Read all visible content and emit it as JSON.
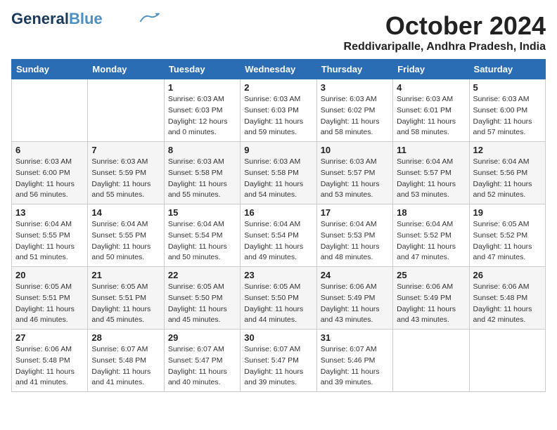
{
  "logo": {
    "line1": "General",
    "line2": "Blue"
  },
  "title": "October 2024",
  "location": "Reddivaripalle, Andhra Pradesh, India",
  "weekdays": [
    "Sunday",
    "Monday",
    "Tuesday",
    "Wednesday",
    "Thursday",
    "Friday",
    "Saturday"
  ],
  "weeks": [
    [
      {
        "day": "",
        "info": ""
      },
      {
        "day": "",
        "info": ""
      },
      {
        "day": "1",
        "info": "Sunrise: 6:03 AM\nSunset: 6:03 PM\nDaylight: 12 hours\nand 0 minutes."
      },
      {
        "day": "2",
        "info": "Sunrise: 6:03 AM\nSunset: 6:03 PM\nDaylight: 11 hours\nand 59 minutes."
      },
      {
        "day": "3",
        "info": "Sunrise: 6:03 AM\nSunset: 6:02 PM\nDaylight: 11 hours\nand 58 minutes."
      },
      {
        "day": "4",
        "info": "Sunrise: 6:03 AM\nSunset: 6:01 PM\nDaylight: 11 hours\nand 58 minutes."
      },
      {
        "day": "5",
        "info": "Sunrise: 6:03 AM\nSunset: 6:00 PM\nDaylight: 11 hours\nand 57 minutes."
      }
    ],
    [
      {
        "day": "6",
        "info": "Sunrise: 6:03 AM\nSunset: 6:00 PM\nDaylight: 11 hours\nand 56 minutes."
      },
      {
        "day": "7",
        "info": "Sunrise: 6:03 AM\nSunset: 5:59 PM\nDaylight: 11 hours\nand 55 minutes."
      },
      {
        "day": "8",
        "info": "Sunrise: 6:03 AM\nSunset: 5:58 PM\nDaylight: 11 hours\nand 55 minutes."
      },
      {
        "day": "9",
        "info": "Sunrise: 6:03 AM\nSunset: 5:58 PM\nDaylight: 11 hours\nand 54 minutes."
      },
      {
        "day": "10",
        "info": "Sunrise: 6:03 AM\nSunset: 5:57 PM\nDaylight: 11 hours\nand 53 minutes."
      },
      {
        "day": "11",
        "info": "Sunrise: 6:04 AM\nSunset: 5:57 PM\nDaylight: 11 hours\nand 53 minutes."
      },
      {
        "day": "12",
        "info": "Sunrise: 6:04 AM\nSunset: 5:56 PM\nDaylight: 11 hours\nand 52 minutes."
      }
    ],
    [
      {
        "day": "13",
        "info": "Sunrise: 6:04 AM\nSunset: 5:55 PM\nDaylight: 11 hours\nand 51 minutes."
      },
      {
        "day": "14",
        "info": "Sunrise: 6:04 AM\nSunset: 5:55 PM\nDaylight: 11 hours\nand 50 minutes."
      },
      {
        "day": "15",
        "info": "Sunrise: 6:04 AM\nSunset: 5:54 PM\nDaylight: 11 hours\nand 50 minutes."
      },
      {
        "day": "16",
        "info": "Sunrise: 6:04 AM\nSunset: 5:54 PM\nDaylight: 11 hours\nand 49 minutes."
      },
      {
        "day": "17",
        "info": "Sunrise: 6:04 AM\nSunset: 5:53 PM\nDaylight: 11 hours\nand 48 minutes."
      },
      {
        "day": "18",
        "info": "Sunrise: 6:04 AM\nSunset: 5:52 PM\nDaylight: 11 hours\nand 47 minutes."
      },
      {
        "day": "19",
        "info": "Sunrise: 6:05 AM\nSunset: 5:52 PM\nDaylight: 11 hours\nand 47 minutes."
      }
    ],
    [
      {
        "day": "20",
        "info": "Sunrise: 6:05 AM\nSunset: 5:51 PM\nDaylight: 11 hours\nand 46 minutes."
      },
      {
        "day": "21",
        "info": "Sunrise: 6:05 AM\nSunset: 5:51 PM\nDaylight: 11 hours\nand 45 minutes."
      },
      {
        "day": "22",
        "info": "Sunrise: 6:05 AM\nSunset: 5:50 PM\nDaylight: 11 hours\nand 45 minutes."
      },
      {
        "day": "23",
        "info": "Sunrise: 6:05 AM\nSunset: 5:50 PM\nDaylight: 11 hours\nand 44 minutes."
      },
      {
        "day": "24",
        "info": "Sunrise: 6:06 AM\nSunset: 5:49 PM\nDaylight: 11 hours\nand 43 minutes."
      },
      {
        "day": "25",
        "info": "Sunrise: 6:06 AM\nSunset: 5:49 PM\nDaylight: 11 hours\nand 43 minutes."
      },
      {
        "day": "26",
        "info": "Sunrise: 6:06 AM\nSunset: 5:48 PM\nDaylight: 11 hours\nand 42 minutes."
      }
    ],
    [
      {
        "day": "27",
        "info": "Sunrise: 6:06 AM\nSunset: 5:48 PM\nDaylight: 11 hours\nand 41 minutes."
      },
      {
        "day": "28",
        "info": "Sunrise: 6:07 AM\nSunset: 5:48 PM\nDaylight: 11 hours\nand 41 minutes."
      },
      {
        "day": "29",
        "info": "Sunrise: 6:07 AM\nSunset: 5:47 PM\nDaylight: 11 hours\nand 40 minutes."
      },
      {
        "day": "30",
        "info": "Sunrise: 6:07 AM\nSunset: 5:47 PM\nDaylight: 11 hours\nand 39 minutes."
      },
      {
        "day": "31",
        "info": "Sunrise: 6:07 AM\nSunset: 5:46 PM\nDaylight: 11 hours\nand 39 minutes."
      },
      {
        "day": "",
        "info": ""
      },
      {
        "day": "",
        "info": ""
      }
    ]
  ]
}
